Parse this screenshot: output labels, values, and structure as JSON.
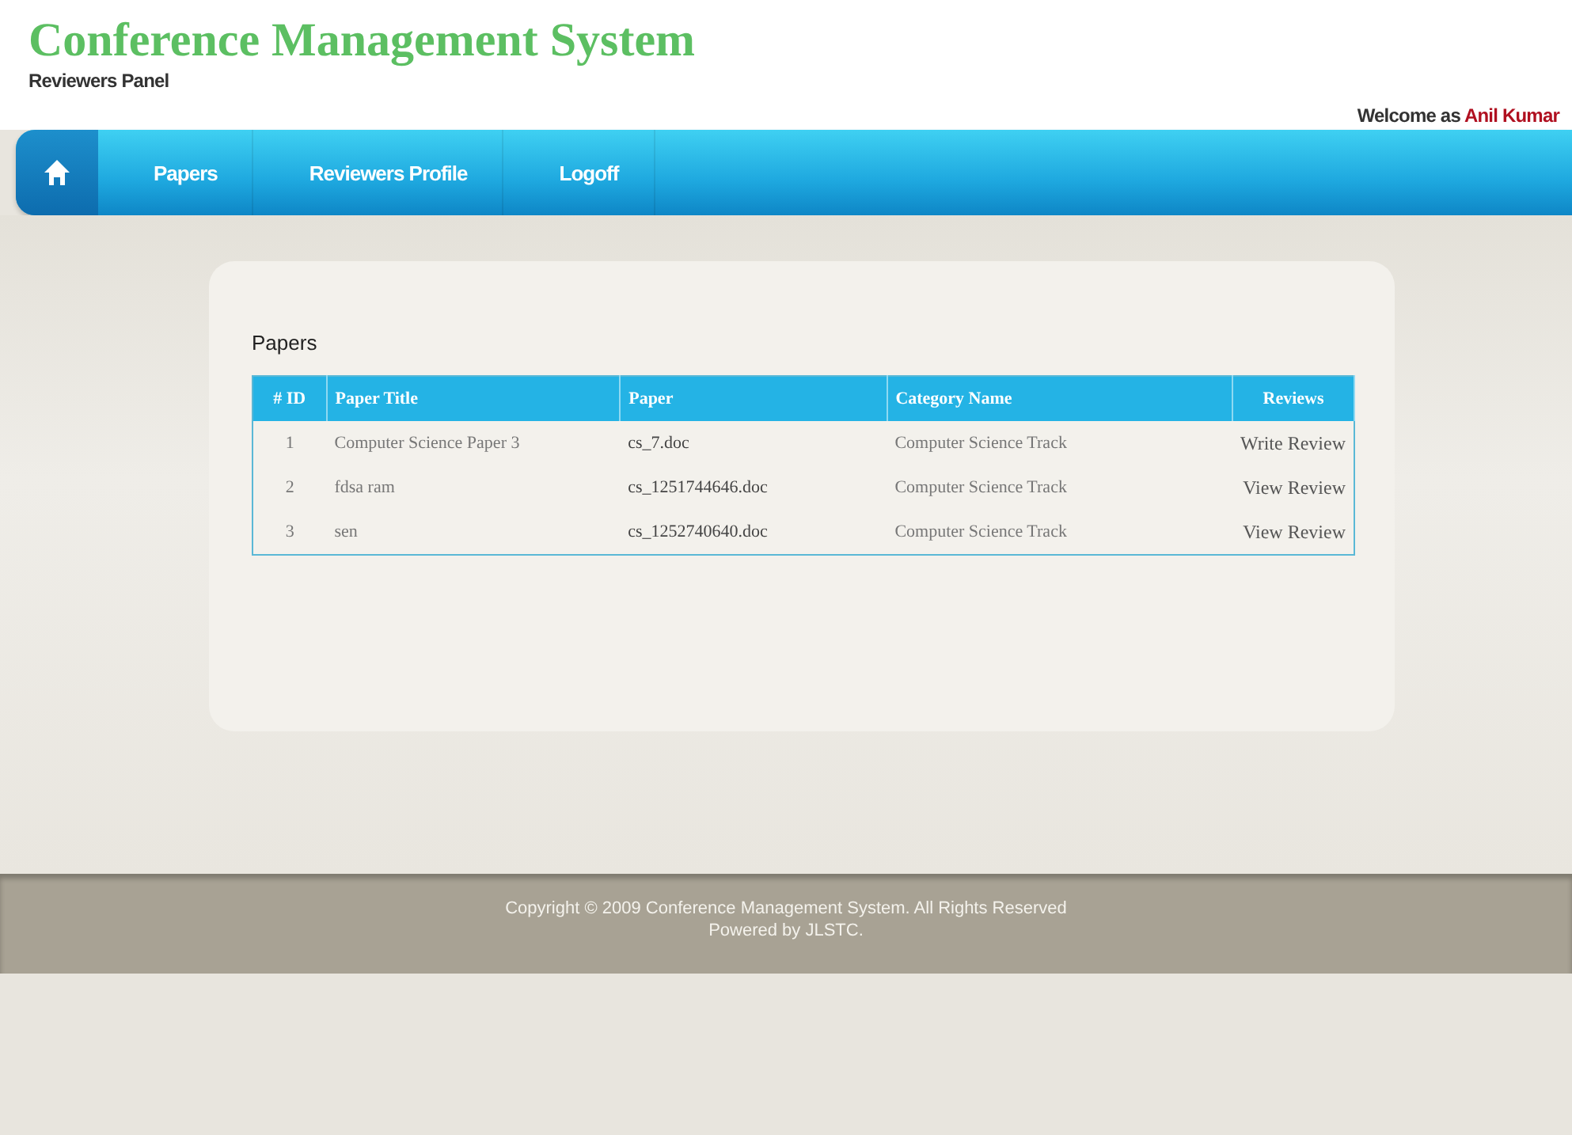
{
  "header": {
    "title": "Conference Management System",
    "subtitle": "Reviewers Panel",
    "welcome": "Welcome as",
    "user": "Anil Kumar"
  },
  "nav": {
    "items": [
      {
        "kind": "home"
      },
      {
        "kind": "link",
        "label": "Papers"
      },
      {
        "kind": "link",
        "label": "Reviewers Profile"
      },
      {
        "kind": "link",
        "label": "Logoff"
      }
    ]
  },
  "panel": {
    "title": "Papers",
    "table": {
      "columns": [
        "# ID",
        "Paper Title",
        "Paper",
        "Category Name",
        "Reviews"
      ],
      "rows": [
        [
          "1",
          "Computer Science Paper 3",
          "cs_7.doc",
          "Computer Science Track",
          "Write Review"
        ],
        [
          "2",
          "fdsa ram",
          "cs_1251744646.doc",
          "Computer Science Track",
          "View Review"
        ],
        [
          "3",
          "sen",
          "cs_1252740640.doc",
          "Computer Science Track",
          "View Review"
        ]
      ]
    }
  },
  "footer": {
    "copyright": "Copyright © 2009 Conference Management System. All Rights Reserved",
    "powered": "Powered by JLSTC."
  }
}
